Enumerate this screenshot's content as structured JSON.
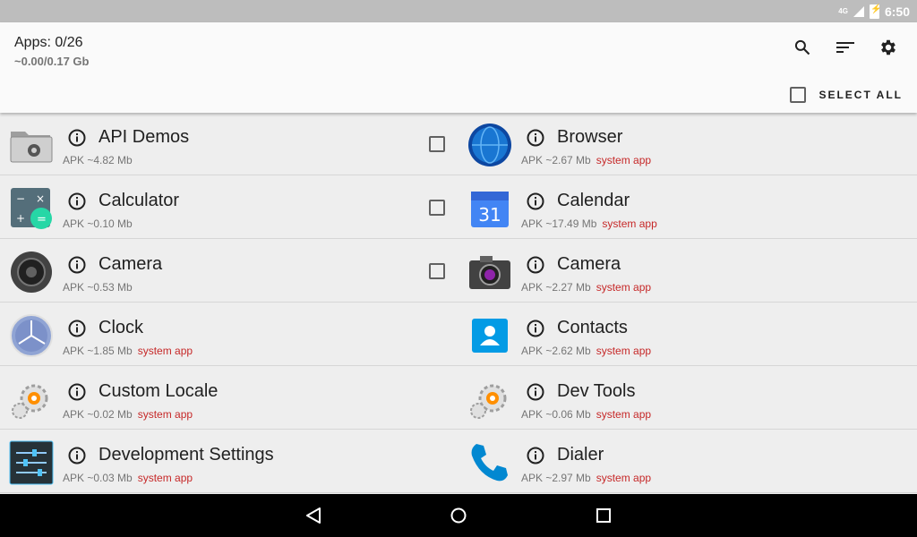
{
  "status": {
    "network": "4G",
    "time": "6:50"
  },
  "header": {
    "title": "Apps: 0/26",
    "subtitle": "~0.00/0.17 Gb",
    "select_all_label": "SELECT ALL"
  },
  "apps_left": [
    {
      "name": "API Demos",
      "size": "APK ~4.82 Mb",
      "tag": "",
      "icon": "folder-gear-icon"
    },
    {
      "name": "Calculator",
      "size": "APK ~0.10 Mb",
      "tag": "",
      "icon": "calculator-icon"
    },
    {
      "name": "Camera",
      "size": "APK ~0.53 Mb",
      "tag": "",
      "icon": "camera-lens-icon"
    },
    {
      "name": "Clock",
      "size": "APK ~1.85 Mb",
      "tag": "system app",
      "icon": "clock-icon"
    },
    {
      "name": "Custom Locale",
      "size": "APK ~0.02 Mb",
      "tag": "system app",
      "icon": "gears-icon"
    },
    {
      "name": "Development Settings",
      "size": "APK ~0.03 Mb",
      "tag": "system app",
      "icon": "sliders-icon"
    }
  ],
  "apps_right": [
    {
      "name": "Browser",
      "size": "APK ~2.67 Mb",
      "tag": "system app",
      "icon": "globe-icon"
    },
    {
      "name": "Calendar",
      "size": "APK ~17.49 Mb",
      "tag": "system app",
      "icon": "calendar-icon",
      "calendar_day": "31"
    },
    {
      "name": "Camera",
      "size": "APK ~2.27 Mb",
      "tag": "system app",
      "icon": "camera-icon"
    },
    {
      "name": "Contacts",
      "size": "APK ~2.62 Mb",
      "tag": "system app",
      "icon": "contacts-icon"
    },
    {
      "name": "Dev Tools",
      "size": "APK ~0.06 Mb",
      "tag": "system app",
      "icon": "gears-icon"
    },
    {
      "name": "Dialer",
      "size": "APK ~2.97 Mb",
      "tag": "system app",
      "icon": "phone-icon"
    }
  ],
  "colors": {
    "system_tag": "#c62828",
    "accent": "#000000"
  }
}
